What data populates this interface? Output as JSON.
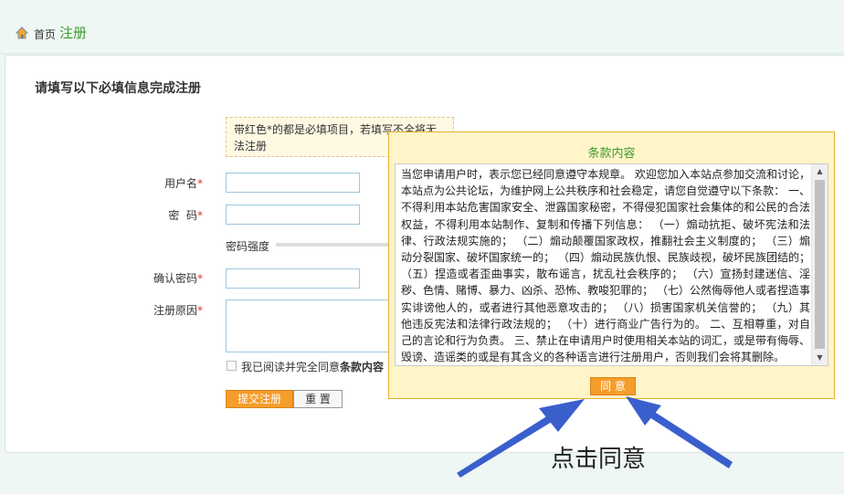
{
  "breadcrumb": {
    "home": "首页",
    "current": "注册"
  },
  "form": {
    "heading": "请填写以下必填信息完成注册",
    "notice": "带红色*的都是必填项目，若填写不全将无法注册",
    "username_label": "用户名",
    "password_label": "密  码",
    "password_strength_label": "密码强度",
    "confirm_label": "确认密码",
    "reason_label": "注册原因",
    "required_mark": "*",
    "agree_prefix": "我已阅读并完全同意",
    "agree_link": "条款内容",
    "submit_label": "提交注册",
    "reset_label": "重 置"
  },
  "dialog": {
    "title": "条款内容",
    "terms": "当您申请用户时，表示您已经同意遵守本规章。 欢迎您加入本站点参加交流和讨论，本站点为公共论坛，为维护网上公共秩序和社会稳定，请您自觉遵守以下条款： 一、不得利用本站危害国家安全、泄露国家秘密，不得侵犯国家社会集体的和公民的合法权益，不得利用本站制作、复制和传播下列信息： （一）煽动抗拒、破坏宪法和法律、行政法规实施的； （二）煽动颠覆国家政权，推翻社会主义制度的； （三）煽动分裂国家、破坏国家统一的； （四）煽动民族仇恨、民族歧视，破坏民族团结的； （五）捏造或者歪曲事实，散布谣言，扰乱社会秩序的； （六）宣扬封建迷信、淫秽、色情、赌博、暴力、凶杀、恐怖、教唆犯罪的； （七）公然侮辱他人或者捏造事实诽谤他人的，或者进行其他恶意攻击的； （八）损害国家机关信誉的； （九）其他违反宪法和法律行政法规的； （十）进行商业广告行为的。 二、互相尊重，对自己的言论和行为负责。 三、禁止在申请用户时使用相关本站的词汇，或是带有侮辱、毁谤、造谣类的或是有其含义的各种语言进行注册用户，否则我们会将其删除。",
    "agree_button": "同 意"
  },
  "annotation": {
    "text": "点击同意",
    "color": "#3a5fcd"
  },
  "colors": {
    "accent_orange": "#f59d2b",
    "title_green": "#3e9a2e",
    "dialog_bg": "#fff5c8"
  }
}
